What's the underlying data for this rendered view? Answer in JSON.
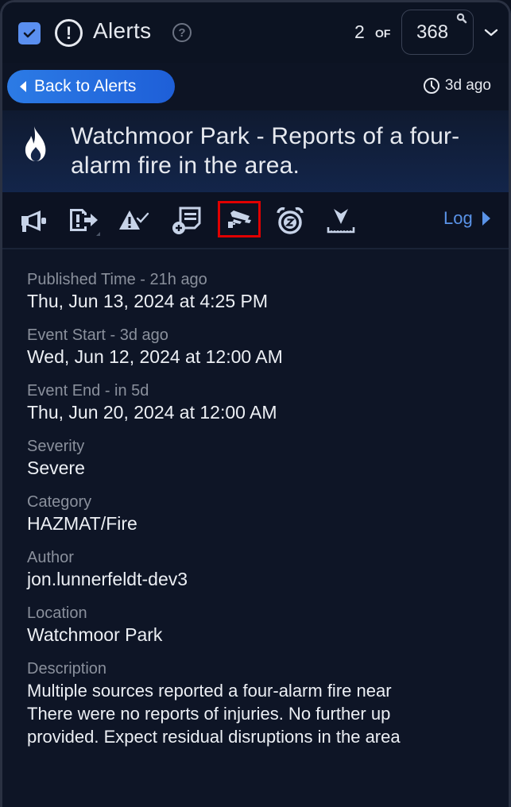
{
  "header": {
    "title": "Alerts",
    "checkbox_checked": true,
    "pager": {
      "current": "2",
      "of_label": "OF",
      "total": "368"
    }
  },
  "subbar": {
    "back_label": "Back to Alerts",
    "time_ago": "3d ago"
  },
  "alert": {
    "title": "Watchmoor Park - Reports of a four-alarm fire in the area.",
    "icon": "fire-icon"
  },
  "toolbar": {
    "tools": [
      {
        "icon": "megaphone-icon",
        "label": "Broadcast"
      },
      {
        "icon": "export-alert-icon",
        "label": "Export Alert"
      },
      {
        "icon": "acknowledge-warning-icon",
        "label": "Acknowledge"
      },
      {
        "icon": "add-note-icon",
        "label": "Add Note"
      },
      {
        "icon": "security-camera-icon",
        "label": "Cameras",
        "highlighted": true
      },
      {
        "icon": "snooze-alarm-icon",
        "label": "Snooze"
      },
      {
        "icon": "measure-range-icon",
        "label": "Range"
      }
    ],
    "log_label": "Log"
  },
  "details": {
    "published": {
      "label": "Published Time - 21h ago",
      "value": "Thu, Jun 13, 2024 at 4:25 PM"
    },
    "event_start": {
      "label": "Event Start - 3d ago",
      "value": "Wed, Jun 12, 2024 at 12:00 AM"
    },
    "event_end": {
      "label": "Event End - in 5d",
      "value": "Thu, Jun 20, 2024 at 12:00 AM"
    },
    "severity": {
      "label": "Severity",
      "value": "Severe"
    },
    "category": {
      "label": "Category",
      "value": "HAZMAT/Fire"
    },
    "author": {
      "label": "Author",
      "value": "jon.lunnerfeldt-dev3"
    },
    "location": {
      "label": "Location",
      "value": "Watchmoor Park"
    },
    "description": {
      "label": "Description",
      "lines": [
        "Multiple sources reported a four-alarm fire near",
        "There were no reports of injuries. No further up",
        "provided. Expect residual disruptions in the area"
      ]
    }
  },
  "colors": {
    "accent": "#2c7be5",
    "checkbox": "#5a8ff0",
    "log_link": "#5a93e8",
    "highlight": "#e00000"
  }
}
